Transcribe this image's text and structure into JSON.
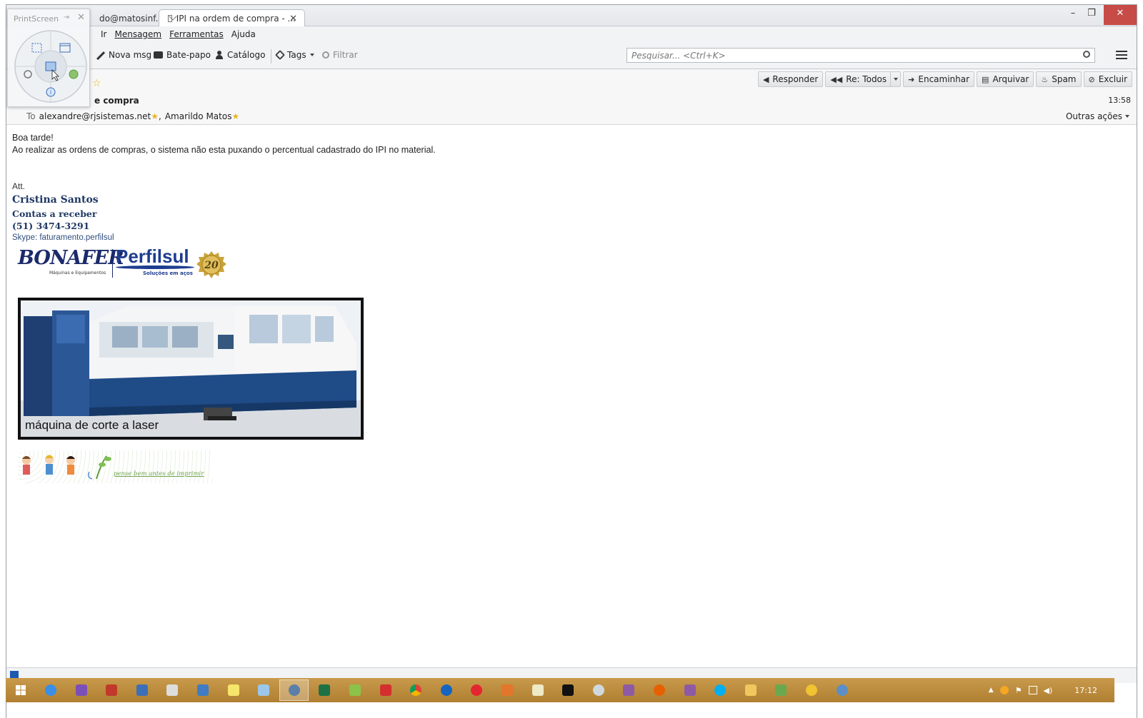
{
  "tabs": [
    {
      "label": "do@matosinf..."
    },
    {
      "label": "IPI na ordem de compra - ..."
    }
  ],
  "menu": [
    "Ir",
    "Mensagem",
    "Ferramentas",
    "Ajuda"
  ],
  "toolbar": {
    "new_msg": "Nova msg",
    "chat": "Bate-papo",
    "catalog": "Catálogo",
    "tags": "Tags",
    "filter": "Filtrar",
    "search_placeholder": "Pesquisar... <Ctrl+K>"
  },
  "actions": {
    "reply": "Responder",
    "reply_all": "Re: Todos",
    "forward": "Encaminhar",
    "archive": "Arquivar",
    "spam": "Spam",
    "delete": "Excluir"
  },
  "message": {
    "subject_visible": "e compra",
    "time": "13:58",
    "to_label": "To",
    "to_1": "alexandre@rjsistemas.net",
    "to_2": "Amarildo Matos",
    "more_actions": "Outras ações",
    "greeting": "Boa tarde!",
    "body": "Ao realizar as ordens de compras, o sistema não esta puxando o percentual cadastrado do IPI no material.",
    "sig_att": "Att.",
    "sig_name": "Cristina Santos",
    "sig_role": "Contas a receber",
    "sig_phone": "(51) 3474-3291",
    "sig_skype": "Skype: faturamento.perfilsul"
  },
  "logos": {
    "bonafer": "BONAFER",
    "bonafer_sub": "Máquinas e Equipamentos",
    "perfilsul": "Perfilsul",
    "perfilsul_sub": "Soluções em aços",
    "seal": "20"
  },
  "image_caption": "máquina de corte a laser",
  "banner_text": "pense bem antes de imprimir",
  "printscreen": {
    "title": "PrintScreen"
  },
  "taskbar": {
    "clock": "17:12",
    "items": [
      "start",
      "ie",
      "vs",
      "filezilla",
      "network",
      "calc",
      "regedit",
      "sticky",
      "notes",
      "chrome-alt",
      "excel",
      "android",
      "acrobat",
      "chrome",
      "edge",
      "opera",
      "matlab",
      "notepad",
      "cmd",
      "disk",
      "winrar",
      "firefox",
      "winrar2",
      "skype",
      "explorer",
      "gadget",
      "soft",
      "thunderbird"
    ],
    "active_item": "chrome-alt"
  },
  "colors": {
    "taskbar": "#b8883a",
    "signature_blue": "#1f3864",
    "star": "#e8b628",
    "close_red": "#c74b46"
  }
}
